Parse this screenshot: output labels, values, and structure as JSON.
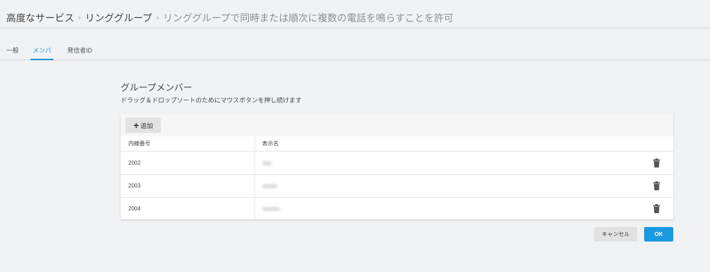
{
  "breadcrumb": {
    "item1": "高度なサービス",
    "separator": "›",
    "item2": "リンググループ",
    "current": "リンググループで同時または順次に複数の電話を鳴らすことを許可"
  },
  "tabs": [
    {
      "label": "一般",
      "active": false
    },
    {
      "label": "メンバー",
      "active": true
    },
    {
      "label": "発信者ID",
      "active": false
    }
  ],
  "section": {
    "title": "グループメンバー",
    "subtitle": "ドラッグ＆ドロップソートのためにマウスボタンを押し続けます"
  },
  "toolbar": {
    "add_label": "追加",
    "add_icon": "plus-icon"
  },
  "table": {
    "headers": [
      "内線番号",
      "表示名"
    ],
    "rows": [
      {
        "extension": "2002",
        "name": "",
        "action_icon": "trash-icon"
      },
      {
        "extension": "2003",
        "name": "",
        "action_icon": "trash-icon"
      },
      {
        "extension": "2004",
        "name": "",
        "action_icon": "trash-icon"
      }
    ]
  },
  "footer": {
    "cancel_label": "キャンセル",
    "ok_label": "OK"
  },
  "colors": {
    "accent": "#1a9ae0",
    "background": "#f1f2f4",
    "button_gray": "#e2e2e2"
  }
}
